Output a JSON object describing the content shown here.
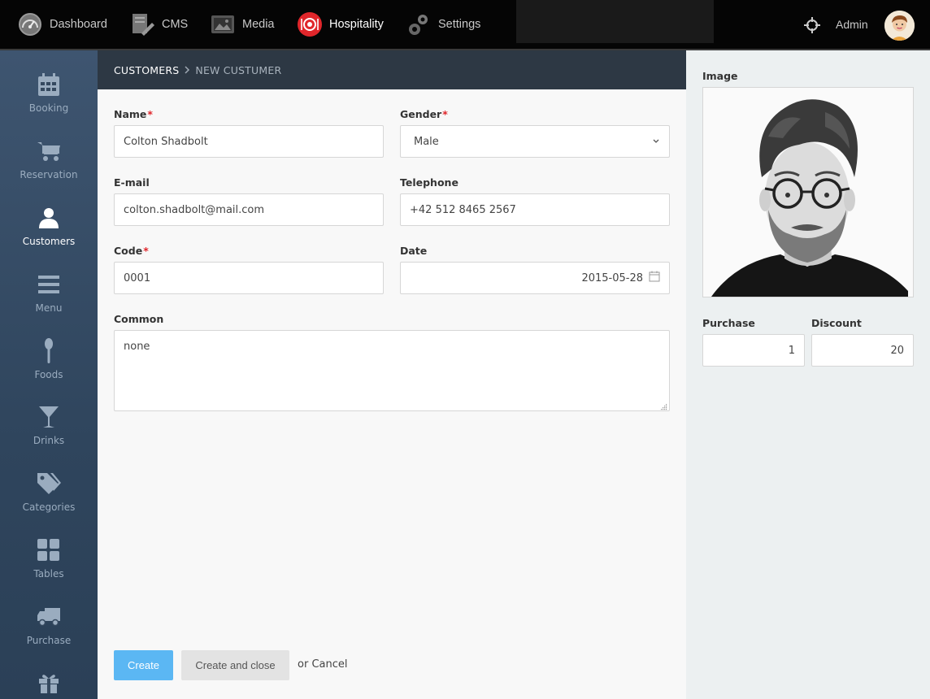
{
  "topnav": {
    "items": [
      {
        "label": "Dashboard",
        "icon": "speedometer-icon"
      },
      {
        "label": "CMS",
        "icon": "cms-icon"
      },
      {
        "label": "Media",
        "icon": "media-icon"
      },
      {
        "label": "Hospitality",
        "icon": "hospitality-plate-icon",
        "active": true
      },
      {
        "label": "Settings",
        "icon": "gears-icon"
      }
    ],
    "user": "Admin",
    "accent_color": "#e0262b"
  },
  "sidebar": {
    "items": [
      {
        "label": "Booking",
        "icon": "calendar-icon"
      },
      {
        "label": "Reservation",
        "icon": "cart-icon"
      },
      {
        "label": "Customers",
        "icon": "user-icon",
        "active": true
      },
      {
        "label": "Menu",
        "icon": "menu-lines-icon"
      },
      {
        "label": "Foods",
        "icon": "spoon-icon"
      },
      {
        "label": "Drinks",
        "icon": "cocktail-icon"
      },
      {
        "label": "Categories",
        "icon": "tags-icon"
      },
      {
        "label": "Tables",
        "icon": "grid-icon"
      },
      {
        "label": "Purchase",
        "icon": "truck-icon"
      },
      {
        "label": "",
        "icon": "gift-icon"
      }
    ]
  },
  "breadcrumb": {
    "parent": "CUSTOMERS",
    "separator": ">",
    "current": "NEW CUSTUMER"
  },
  "form": {
    "name": {
      "label": "Name",
      "value": "Colton Shadbolt",
      "required": "*"
    },
    "gender": {
      "label": "Gender",
      "value": "Male",
      "required": "*"
    },
    "email": {
      "label": "E-mail",
      "value": "colton.shadbolt@mail.com"
    },
    "telephone": {
      "label": "Telephone",
      "value": "+42 512 8465 2567"
    },
    "code": {
      "label": "Code",
      "value": "0001",
      "required": "*"
    },
    "date": {
      "label": "Date",
      "value": "2015-05-28"
    },
    "common": {
      "label": "Common",
      "value": "none"
    }
  },
  "actions": {
    "create": "Create",
    "create_close": "Create and close",
    "or": "or",
    "cancel": "Cancel",
    "primary_color": "#5bb7f3"
  },
  "side_panel": {
    "image_label": "Image",
    "purchase": {
      "label": "Purchase",
      "value": "1"
    },
    "discount": {
      "label": "Discount",
      "value": "20"
    }
  }
}
